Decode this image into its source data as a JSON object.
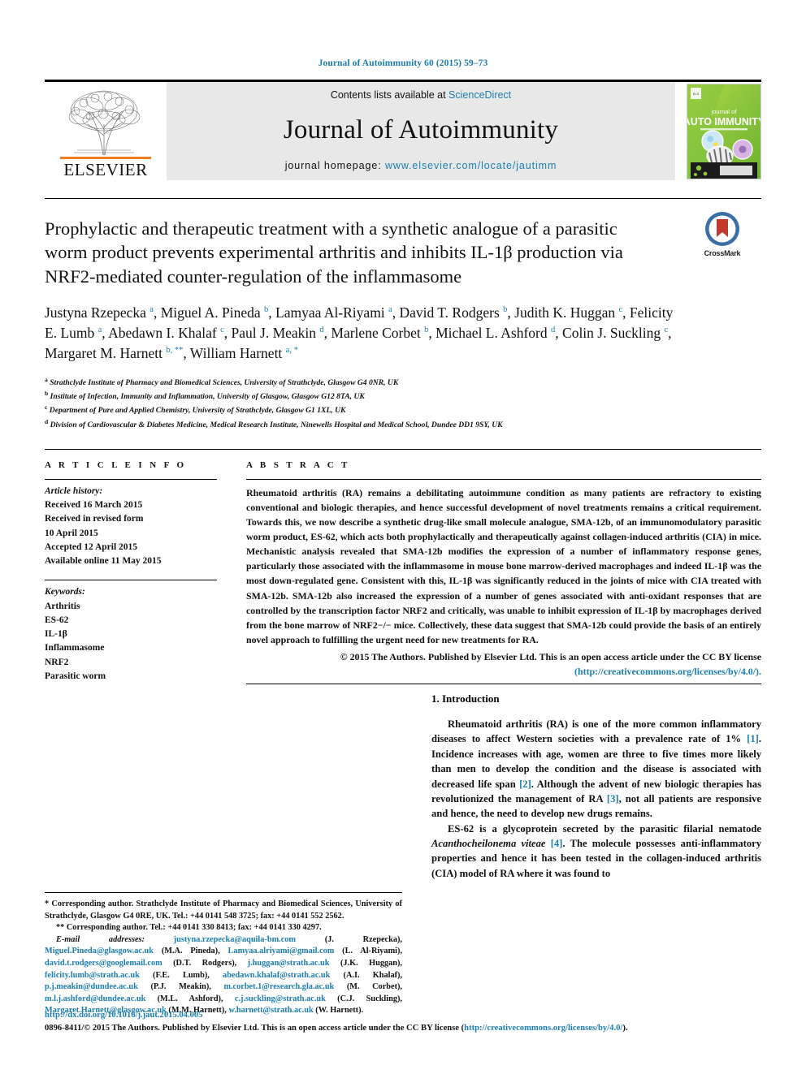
{
  "running_head": "Journal of Autoimmunity 60 (2015) 59–73",
  "masthead": {
    "publisher": "ELSEVIER",
    "contents_prefix": "Contents lists available at ",
    "contents_link": "ScienceDirect",
    "journal_title": "Journal of Autoimmunity",
    "homepage_prefix": "journal homepage: ",
    "homepage_url": "www.elsevier.com/locate/jautimm",
    "cover_line1": "journal of",
    "cover_line2": "AUTO IMMUNITY"
  },
  "crossmark": {
    "label": "CrossMark"
  },
  "article": {
    "title": "Prophylactic and therapeutic treatment with a synthetic analogue of a parasitic worm product prevents experimental arthritis and inhibits IL-1β production via NRF2-mediated counter-regulation of the inflammasome",
    "authors_html": "Justyna Rzepecka <sup>a</sup>, Miguel A. Pineda <sup>b</sup>, Lamyaa Al-Riyami <sup>a</sup>, David T. Rodgers <sup>b</sup>, Judith K. Huggan <sup>c</sup>, Felicity E. Lumb <sup>a</sup>, Abedawn I. Khalaf <sup>c</sup>, Paul J. Meakin <sup>d</sup>, Marlene Corbet <sup>b</sup>, Michael L. Ashford <sup>d</sup>, Colin J. Suckling <sup>c</sup>, Margaret M. Harnett <sup>b, **</sup>, William Harnett <sup>a, *</sup>",
    "affiliations": [
      {
        "mark": "a",
        "text": "Strathclyde Institute of Pharmacy and Biomedical Sciences, University of Strathclyde, Glasgow G4 0NR, UK"
      },
      {
        "mark": "b",
        "text": "Institute of Infection, Immunity and Inflammation, University of Glasgow, Glasgow G12 8TA, UK"
      },
      {
        "mark": "c",
        "text": "Department of Pure and Applied Chemistry, University of Strathclyde, Glasgow G1 1XL, UK"
      },
      {
        "mark": "d",
        "text": "Division of Cardiovascular & Diabetes Medicine, Medical Research Institute, Ninewells Hospital and Medical School, Dundee DD1 9SY, UK"
      }
    ]
  },
  "article_info": {
    "heading": "A R T I C L E   I N F O",
    "history_label": "Article history:",
    "history": [
      "Received 16 March 2015",
      "Received in revised form",
      "10 April 2015",
      "Accepted 12 April 2015",
      "Available online 11 May 2015"
    ],
    "keywords_label": "Keywords:",
    "keywords": [
      "Arthritis",
      "ES-62",
      "IL-1β",
      "Inflammasome",
      "NRF2",
      "Parasitic worm"
    ]
  },
  "abstract": {
    "heading": "A B S T R A C T",
    "body": "Rheumatoid arthritis (RA) remains a debilitating autoimmune condition as many patients are refractory to existing conventional and biologic therapies, and hence successful development of novel treatments remains a critical requirement. Towards this, we now describe a synthetic drug-like small molecule analogue, SMA-12b, of an immunomodulatory parasitic worm product, ES-62, which acts both prophylactically and therapeutically against collagen-induced arthritis (CIA) in mice. Mechanistic analysis revealed that SMA-12b modifies the expression of a number of inflammatory response genes, particularly those associated with the inflammasome in mouse bone marrow-derived macrophages and indeed IL-1β was the most down-regulated gene. Consistent with this, IL-1β was significantly reduced in the joints of mice with CIA treated with SMA-12b. SMA-12b also increased the expression of a number of genes associated with anti-oxidant responses that are controlled by the transcription factor NRF2 and critically, was unable to inhibit expression of IL-1β by macrophages derived from the bone marrow of NRF2−/− mice. Collectively, these data suggest that SMA-12b could provide the basis of an entirely novel approach to fulfilling the urgent need for new treatments for RA.",
    "copyright_line": "© 2015 The Authors. Published by Elsevier Ltd. This is an open access article under the CC BY license",
    "license_url": "(http://creativecommons.org/licenses/by/4.0/)."
  },
  "introduction": {
    "heading": "1. Introduction",
    "paragraph_1": "Rheumatoid arthritis (RA) is one of the more common inflammatory diseases to affect Western societies with a prevalence rate of 1% [1]. Incidence increases with age, women are three to five times more likely than men to develop the condition and the disease is associated with decreased life span [2]. Although the advent of new biologic therapies has revolutionized the management of RA [3], not all patients are responsive and hence, the need to develop new drugs remains.",
    "paragraph_2_pre": "ES-62 is a glycoprotein secreted by the parasitic filarial nematode ",
    "paragraph_2_italic": "Acanthocheilonema viteae",
    "paragraph_2_post": " [4]. The molecule possesses anti-inflammatory properties and hence it has been tested in the collagen-induced arthritis (CIA) model of RA where it was found to"
  },
  "footnotes": {
    "corr1": "* Corresponding author. Strathclyde Institute of Pharmacy and Biomedical Sciences, University of Strathclyde, Glasgow G4 0RE, UK. Tel.: +44 0141 548 3725; fax: +44 0141 552 2562.",
    "corr2": "** Corresponding author. Tel.: +44 0141 330 8413; fax: +44 0141 330 4297.",
    "email_label": "E-mail addresses:",
    "emails": [
      {
        "addr": "justyna.rzepecka@aquila-bm.com",
        "name": "(J. Rzepecka),"
      },
      {
        "addr": "Miguel.Pineda@glasgow.ac.uk",
        "name": "(M.A. Pineda),"
      },
      {
        "addr": "Lamyaa.alriyami@gmail.com",
        "name": "(L. Al-Riyami),"
      },
      {
        "addr": "david.t.rodgers@googlemail.com",
        "name": "(D.T. Rodgers),"
      },
      {
        "addr": "j.huggan@strath.ac.uk",
        "name": "(J.K. Huggan),"
      },
      {
        "addr": "felicity.lumb@strath.ac.uk",
        "name": "(F.E. Lumb),"
      },
      {
        "addr": "abedawn.khalaf@strath.ac.uk",
        "name": "(A.I. Khalaf),"
      },
      {
        "addr": "p.j.meakin@dundee.ac.uk",
        "name": "(P.J. Meakin),"
      },
      {
        "addr": "m.corbet.1@research.gla.ac.uk",
        "name": "(M. Corbet),"
      },
      {
        "addr": "m.l.j.ashford@dundee.ac.uk",
        "name": "(M.L. Ashford),"
      },
      {
        "addr": "c.j.suckling@strath.ac.uk",
        "name": "(C.J. Suckling),"
      },
      {
        "addr": "Margaret.Harnett@glasgow.ac.uk",
        "name": "(M.M. Harnett),"
      },
      {
        "addr": "w.harnett@strath.ac.uk",
        "name": "(W. Harnett)."
      }
    ]
  },
  "page_footer": {
    "doi": "http://dx.doi.org/10.1016/j.jaut.2015.04.005",
    "issn_copyright": "0896-8411/© 2015 The Authors. Published by Elsevier Ltd. This is an open access article under the CC BY license (",
    "license_url": "http://creativecommons.org/licenses/by/4.0/",
    "tail": ")."
  },
  "colors": {
    "link": "#1c7eb0",
    "elsevier_orange": "#f47c20",
    "masthead_bg": "#e8e8e8"
  }
}
